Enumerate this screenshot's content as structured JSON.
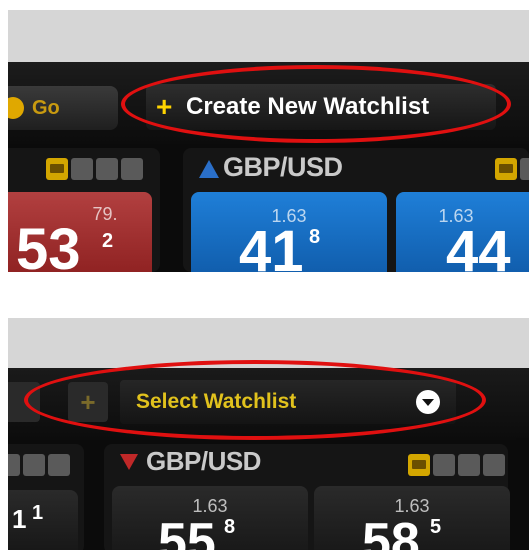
{
  "top": {
    "go_label": "Go",
    "create_watchlist_plus": "+",
    "create_watchlist_label": "Create New Watchlist",
    "left_card": {
      "quote_prefix": "79.",
      "quote_big": "53",
      "quote_sup": "2"
    },
    "gbp_card": {
      "pair": "GBP/USD",
      "bid": {
        "prefix": "1.63",
        "big": "41",
        "sup": "8"
      },
      "ask": {
        "prefix": "1.63",
        "big": "44",
        "sup": ""
      }
    }
  },
  "bottom": {
    "add_label": "+",
    "select_watchlist_label": "Select Watchlist",
    "left_card": {
      "quote_big": "1",
      "quote_sup": "1"
    },
    "gbp_card": {
      "pair": "GBP/USD",
      "bid": {
        "prefix": "1.63",
        "big": "55",
        "sup": "8"
      },
      "ask": {
        "prefix": "1.63",
        "big": "58",
        "sup": "5"
      }
    }
  },
  "colors": {
    "highlight_ellipse": "#e01010",
    "plus_yellow": "#ffd400",
    "select_text": "#e1c21d",
    "buy_blue": "#1f7fd8",
    "sell_red": "#b24040",
    "gold_icon": "#d3a600"
  },
  "icons": [
    "coin-icon",
    "plus-icon",
    "dropdown-icon",
    "up-triangle-icon",
    "down-triangle-icon",
    "trade-icon",
    "chart-icon",
    "edit-icon",
    "close-icon"
  ]
}
